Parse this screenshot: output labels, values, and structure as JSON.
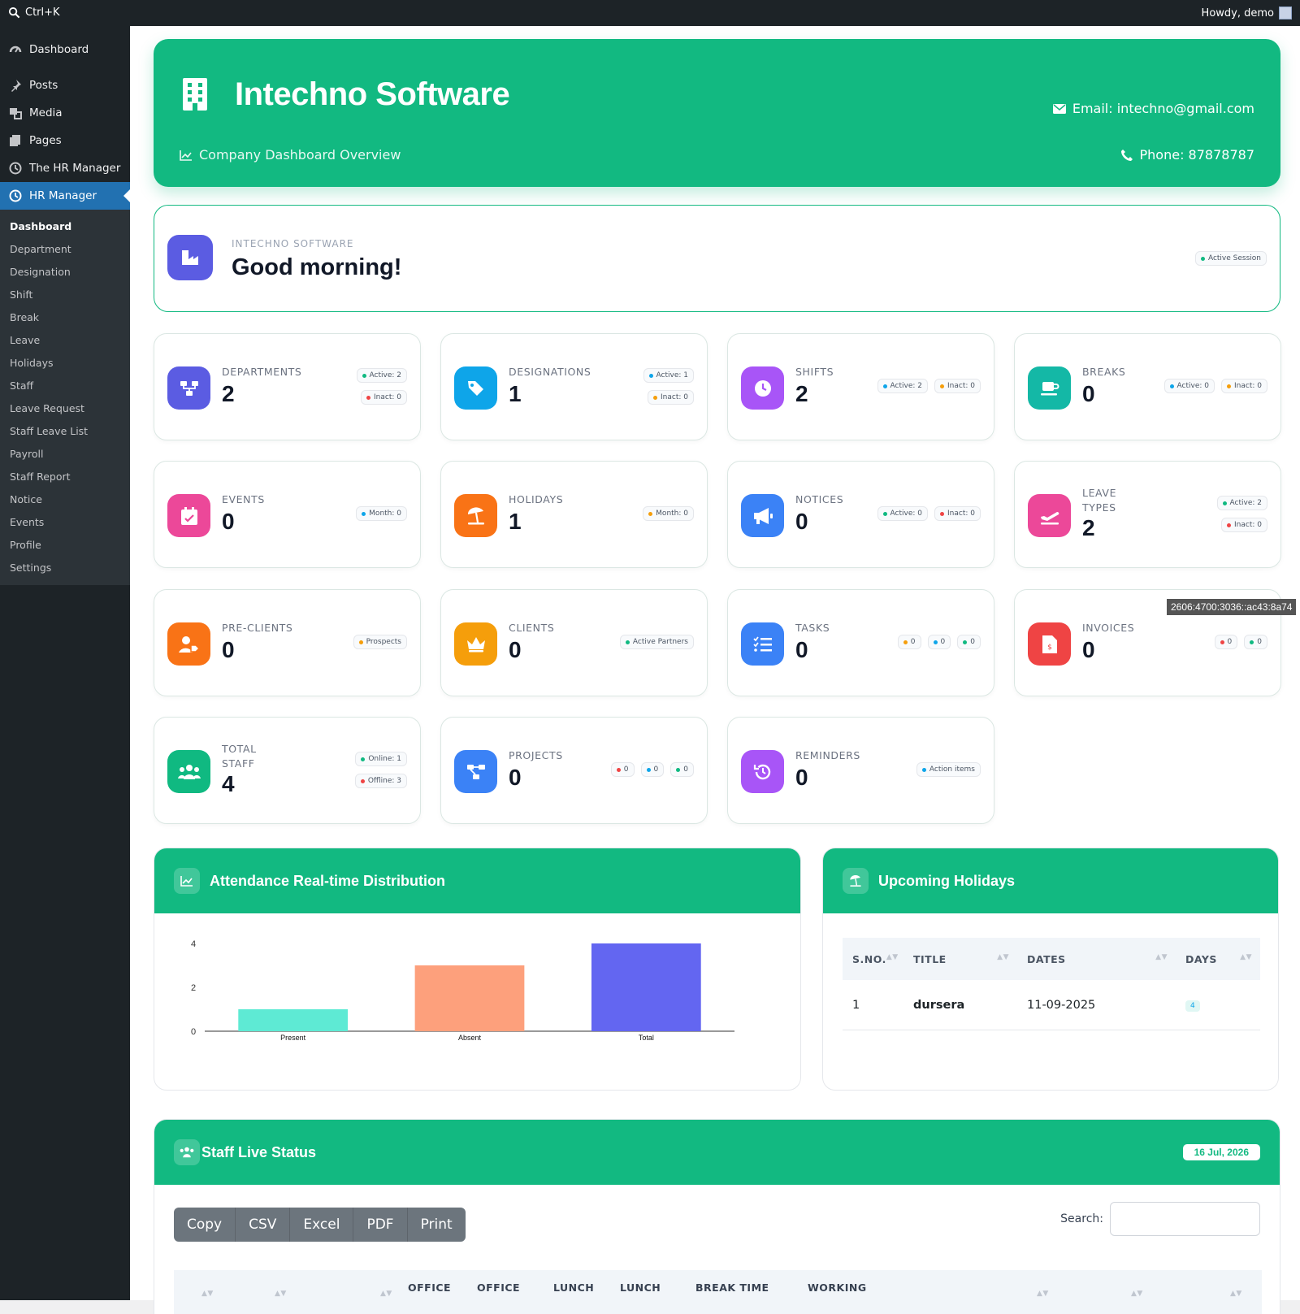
{
  "topbar": {
    "search_shortcut": "Ctrl+K",
    "howdy": "Howdy, demo"
  },
  "menu": {
    "items": [
      {
        "label": "Dashboard",
        "icon": "dashboard-icon"
      },
      {
        "label": "Posts",
        "icon": "pin-icon"
      },
      {
        "label": "Media",
        "icon": "media-icon"
      },
      {
        "label": "Pages",
        "icon": "pages-icon"
      },
      {
        "label": "The HR Manager",
        "icon": "clock-icon"
      },
      {
        "label": "HR Manager",
        "icon": "clock-icon"
      }
    ],
    "submenu": [
      "Dashboard",
      "Department",
      "Designation",
      "Shift",
      "Break",
      "Leave",
      "Holidays",
      "Staff",
      "Leave Request",
      "Staff Leave List",
      "Payroll",
      "Staff Report",
      "Notice",
      "Events",
      "Profile",
      "Settings"
    ]
  },
  "hero": {
    "title": "Intechno Software",
    "subtitle": "Company Dashboard Overview",
    "email": "Email: intechno@gmail.com",
    "phone": "Phone: 87878787"
  },
  "greeting": {
    "org": "INTECHNO SOFTWARE",
    "message": "Good morning!",
    "badge": "Active Session"
  },
  "cards": [
    {
      "label1": "DEPARTMENTS",
      "value": "2",
      "b1": "Active: 2",
      "b2": "Inact: 0"
    },
    {
      "label1": "DESIGNATIONS",
      "value": "1",
      "b1": "Active: 1",
      "b2": "Inact: 0"
    },
    {
      "label1": "SHIFTS",
      "value": "2",
      "b1": "Active: 2",
      "b2": "Inact: 0"
    },
    {
      "label1": "BREAKS",
      "value": "0",
      "b1": "Active: 0",
      "b2": "Inact: 0"
    },
    {
      "label1": "EVENTS",
      "value": "0",
      "b1": "Month: 0"
    },
    {
      "label1": "HOLIDAYS",
      "value": "1",
      "b1": "Month: 0"
    },
    {
      "label1": "NOTICES",
      "value": "0",
      "b1": "Active: 0",
      "b2": "Inact: 0"
    },
    {
      "label1": "LEAVE",
      "label2": "TYPES",
      "value": "2",
      "b1": "Active: 2",
      "b2": "Inact: 0"
    },
    {
      "label1": "PRE-CLIENTS",
      "value": "0",
      "b1": "Prospects"
    },
    {
      "label1": "CLIENTS",
      "value": "0",
      "b1": "Active Partners"
    },
    {
      "label1": "TASKS",
      "value": "0",
      "b1": "0",
      "b2": "0",
      "b3": "0"
    },
    {
      "label1": "INVOICES",
      "value": "0",
      "b1": "0",
      "b2": "0"
    },
    {
      "label1": "TOTAL",
      "label2": "STAFF",
      "value": "4",
      "b1": "Online: 1",
      "b2": "Offline: 3"
    },
    {
      "label1": "PROJECTS",
      "value": "0",
      "b1": "0",
      "b2": "0",
      "b3": "0"
    },
    {
      "label1": "REMINDERS",
      "value": "0",
      "b1": "Action items"
    }
  ],
  "ip_tooltip": "2606:4700:3036::ac43:8a74",
  "attendance": {
    "title": "Attendance Real-time Distribution"
  },
  "chart_data": {
    "type": "bar",
    "categories": [
      "Present",
      "Absent",
      "Total"
    ],
    "values": [
      1,
      3,
      4
    ],
    "colors": [
      "#5eead4",
      "#fda07c",
      "#6366f1"
    ],
    "yticks": [
      "4",
      "2",
      "0"
    ],
    "ylim": [
      0,
      4
    ]
  },
  "holidays": {
    "title": "Upcoming Holidays",
    "columns": [
      "S.NO.",
      "TITLE",
      "DATES",
      "DAYS"
    ],
    "rows": [
      {
        "sno": "1",
        "title": "dursera",
        "dates": "11-09-2025",
        "days": "4"
      }
    ]
  },
  "staff_live": {
    "title": "Staff Live Status",
    "date": "16 Jul, 2026",
    "buttons": [
      "Copy",
      "CSV",
      "Excel",
      "PDF",
      "Print"
    ],
    "search_label": "Search:",
    "columns": [
      "OFFICE",
      "OFFICE",
      "LUNCH",
      "LUNCH",
      "BREAK TIME",
      "WORKING"
    ]
  }
}
